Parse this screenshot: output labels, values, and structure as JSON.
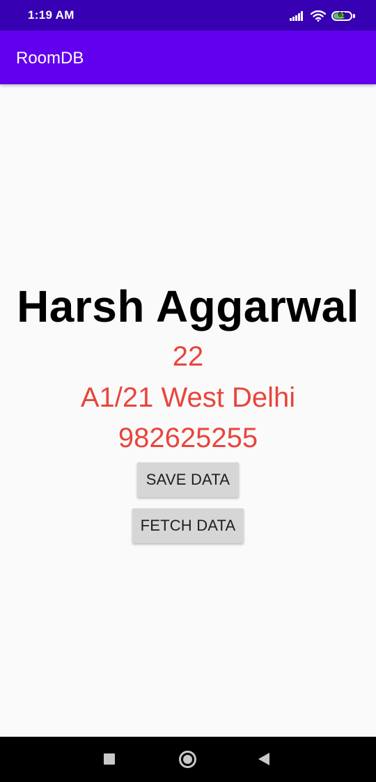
{
  "status_bar": {
    "time": "1:19 AM",
    "battery_level": "61",
    "icons": [
      "signal-icon",
      "wifi-icon",
      "battery-icon"
    ]
  },
  "app_bar": {
    "title": "RoomDB"
  },
  "profile": {
    "name": "Harsh Aggarwal",
    "age": "22",
    "address": "A1/21 West Delhi",
    "phone": "982625255"
  },
  "buttons": {
    "save_label": "SAVE DATA",
    "fetch_label": "FETCH DATA"
  },
  "nav_bar": {
    "icons": [
      "recents-icon",
      "home-icon",
      "back-icon"
    ]
  },
  "colors": {
    "status_bar": "#3700b3",
    "app_bar": "#6200ee",
    "accent_text": "#e8453c",
    "button": "#d6d6d6",
    "background": "#fafafa"
  }
}
